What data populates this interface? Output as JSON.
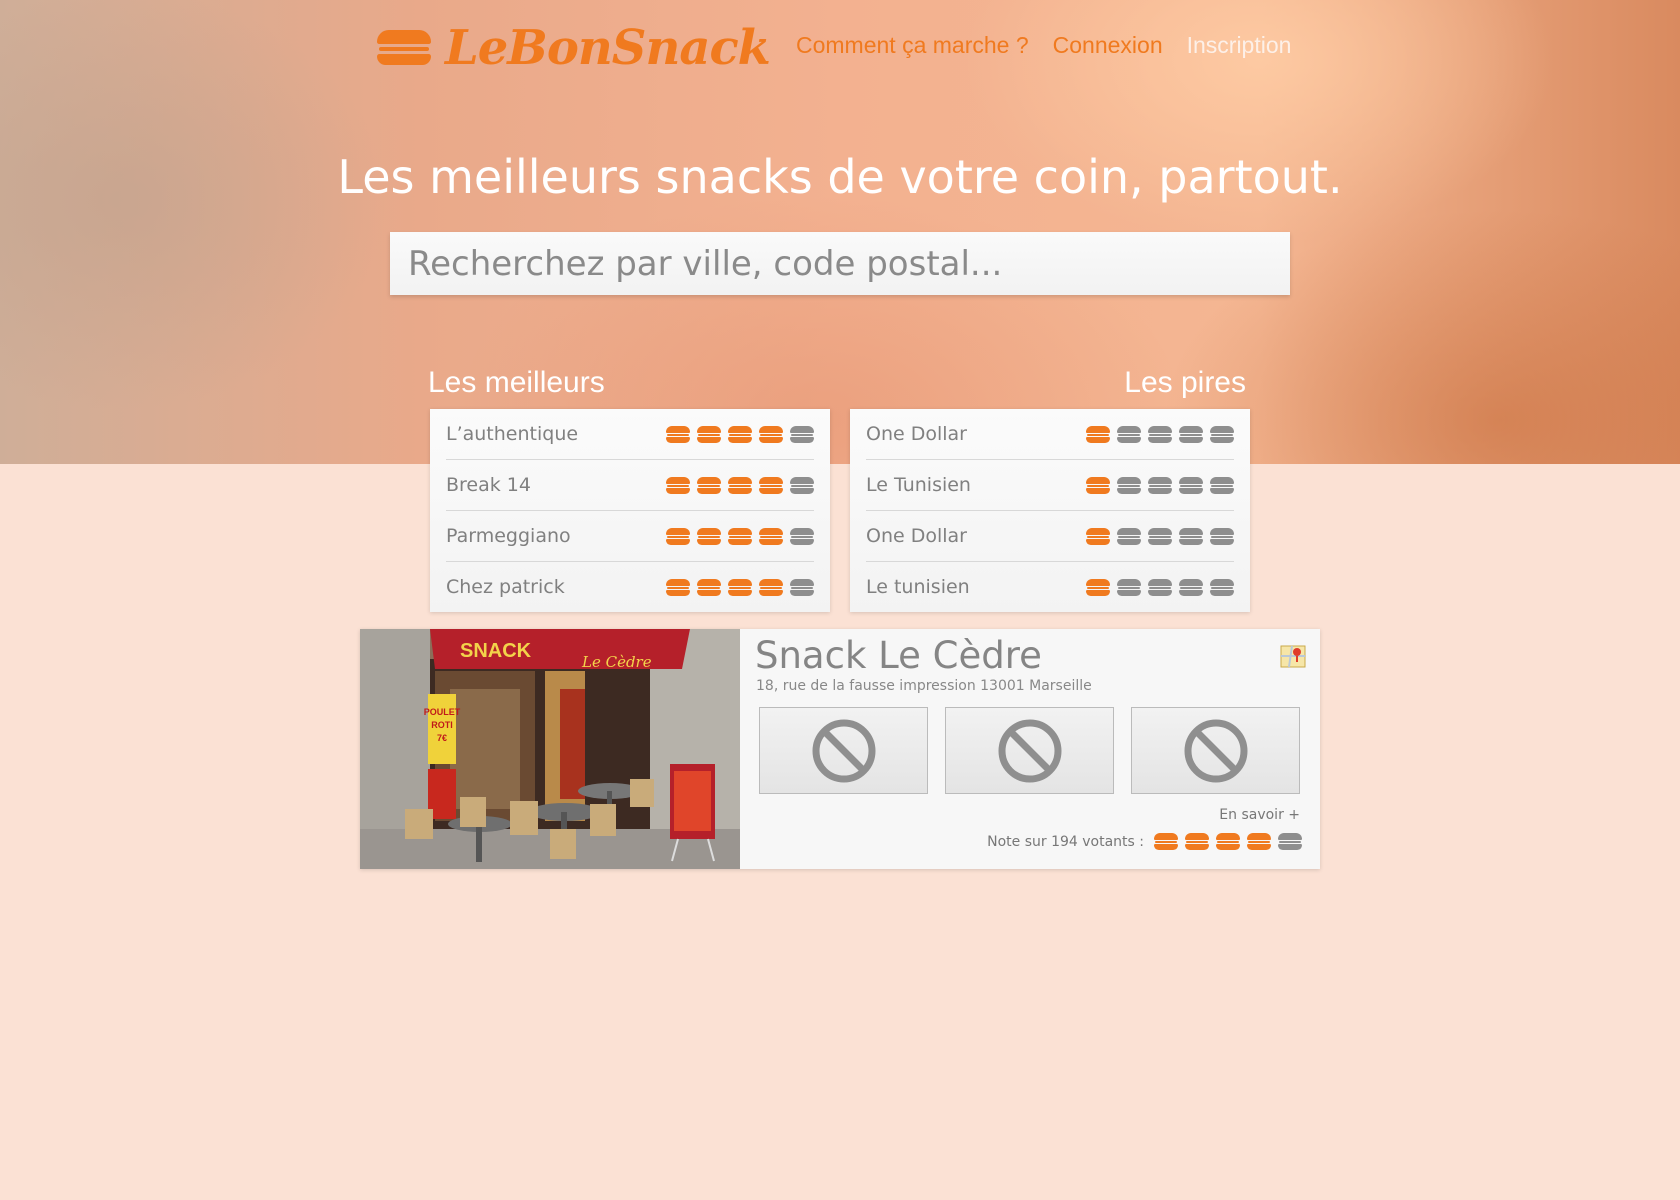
{
  "brand": {
    "name": "LeBonSnack",
    "accent": "#f07a1f",
    "icon": "burger-icon"
  },
  "nav": [
    {
      "label": "Comment ça marche ?"
    },
    {
      "label": "Connexion"
    },
    {
      "label": "Inscription"
    }
  ],
  "hero": {
    "headline": "Les meilleurs snacks de votre coin, partout.",
    "search_placeholder": "Recherchez par ville, code postal..."
  },
  "best": {
    "title": "Les meilleurs",
    "items": [
      {
        "name": "L’authentique",
        "rating": 4
      },
      {
        "name": "Break 14",
        "rating": 4
      },
      {
        "name": "Parmeggiano",
        "rating": 4
      },
      {
        "name": "Chez patrick",
        "rating": 4
      }
    ]
  },
  "worst": {
    "title": "Les pires",
    "items": [
      {
        "name": "One Dollar",
        "rating": 1
      },
      {
        "name": "Le Tunisien",
        "rating": 1
      },
      {
        "name": "One Dollar",
        "rating": 1
      },
      {
        "name": "Le tunisien",
        "rating": 1
      }
    ]
  },
  "featured": {
    "name": "Snack Le Cèdre",
    "address": "18, rue de la fausse impression 13001 Marseille",
    "photo_sign": "SNACK",
    "photo_sign_script": "Le Cèdre",
    "photo_poster": [
      "POULET",
      "ROTI",
      "7€"
    ],
    "map_icon": "map-icon",
    "thumbnail_icon": "no-image-icon",
    "more_label": "En savoir +",
    "note_label": "Note sur 194 votants :",
    "rating": 4
  },
  "rating_max": 5,
  "colors": {
    "rating_on": "#f07a1f",
    "rating_off": "#8e8e8e",
    "page_bg": "#fbe1d4"
  }
}
